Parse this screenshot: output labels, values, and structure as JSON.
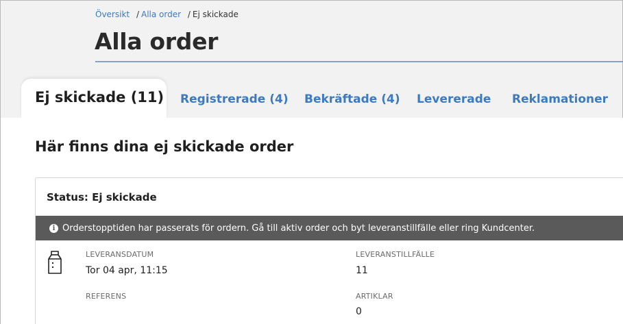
{
  "breadcrumb": {
    "items": [
      "Översikt",
      "Alla order"
    ],
    "separator": "/",
    "current": "Ej skickade"
  },
  "page": {
    "title": "Alla order"
  },
  "tabs": [
    {
      "label": "Ej skickade (11)",
      "active": true
    },
    {
      "label": "Registrerade (4)",
      "active": false
    },
    {
      "label": "Bekräftade (4)",
      "active": false
    },
    {
      "label": "Levererade",
      "active": false
    },
    {
      "label": "Reklamationer",
      "active": false
    }
  ],
  "section": {
    "heading": "Här finns dina ej skickade order"
  },
  "order": {
    "status": "Status: Ej skickade",
    "warning": "Orderstopptiden har passerats för ordern. Gå till aktiv order och byt leveranstillfälle eller ring Kundcenter.",
    "fields": {
      "leveransdatum": {
        "label": "LEVERANSDATUM",
        "value": "Tor 04 apr, 11:15"
      },
      "leveranstillfalle": {
        "label": "LEVERANSTILLFÄLLE",
        "value": "11"
      },
      "referens": {
        "label": "REFERENS",
        "value": ""
      },
      "artiklar": {
        "label": "ARTIKLAR",
        "value": "0"
      }
    }
  },
  "icons": {
    "info": "info-icon",
    "product": "milk-carton-icon"
  },
  "colors": {
    "link": "#3c7ac2",
    "warning_bg": "#5a5a5a",
    "title_rule": "#7fa3cf"
  }
}
